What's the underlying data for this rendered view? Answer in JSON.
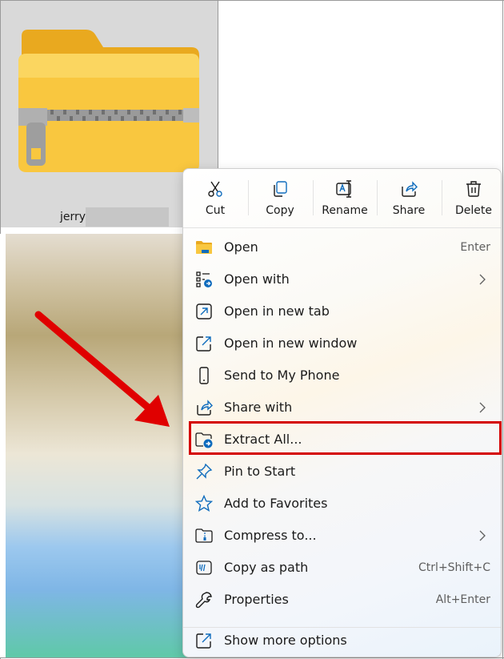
{
  "file": {
    "name": "jerry",
    "icon": "zip-folder-icon"
  },
  "toolbar": [
    {
      "label": "Cut",
      "icon": "cut-icon"
    },
    {
      "label": "Copy",
      "icon": "copy-icon"
    },
    {
      "label": "Rename",
      "icon": "rename-icon"
    },
    {
      "label": "Share",
      "icon": "share-icon"
    },
    {
      "label": "Delete",
      "icon": "delete-icon"
    }
  ],
  "menu": {
    "items": [
      {
        "label": "Open",
        "shortcut": "Enter",
        "icon": "folder-icon"
      },
      {
        "label": "Open with",
        "shortcut": "",
        "icon": "open-with-icon",
        "submenu": true
      },
      {
        "label": "Open in new tab",
        "shortcut": "",
        "icon": "new-tab-icon"
      },
      {
        "label": "Open in new window",
        "shortcut": "",
        "icon": "new-window-icon"
      },
      {
        "label": "Send to My Phone",
        "shortcut": "",
        "icon": "phone-icon"
      },
      {
        "label": "Share with",
        "shortcut": "",
        "icon": "share-with-icon",
        "submenu": true
      },
      {
        "label": "Extract All...",
        "shortcut": "",
        "icon": "extract-icon",
        "highlighted": true
      },
      {
        "label": "Pin to Start",
        "shortcut": "",
        "icon": "pin-icon"
      },
      {
        "label": "Add to Favorites",
        "shortcut": "",
        "icon": "star-icon"
      },
      {
        "label": "Compress to...",
        "shortcut": "",
        "icon": "compress-icon",
        "submenu": true
      },
      {
        "label": "Copy as path",
        "shortcut": "Ctrl+Shift+C",
        "icon": "copy-path-icon"
      },
      {
        "label": "Properties",
        "shortcut": "Alt+Enter",
        "icon": "wrench-icon"
      }
    ],
    "more": {
      "label": "Show more options",
      "icon": "show-more-icon"
    }
  },
  "colors": {
    "accent": "#0f6cbd",
    "highlight": "#d40000",
    "folder": "#f9c73f"
  }
}
